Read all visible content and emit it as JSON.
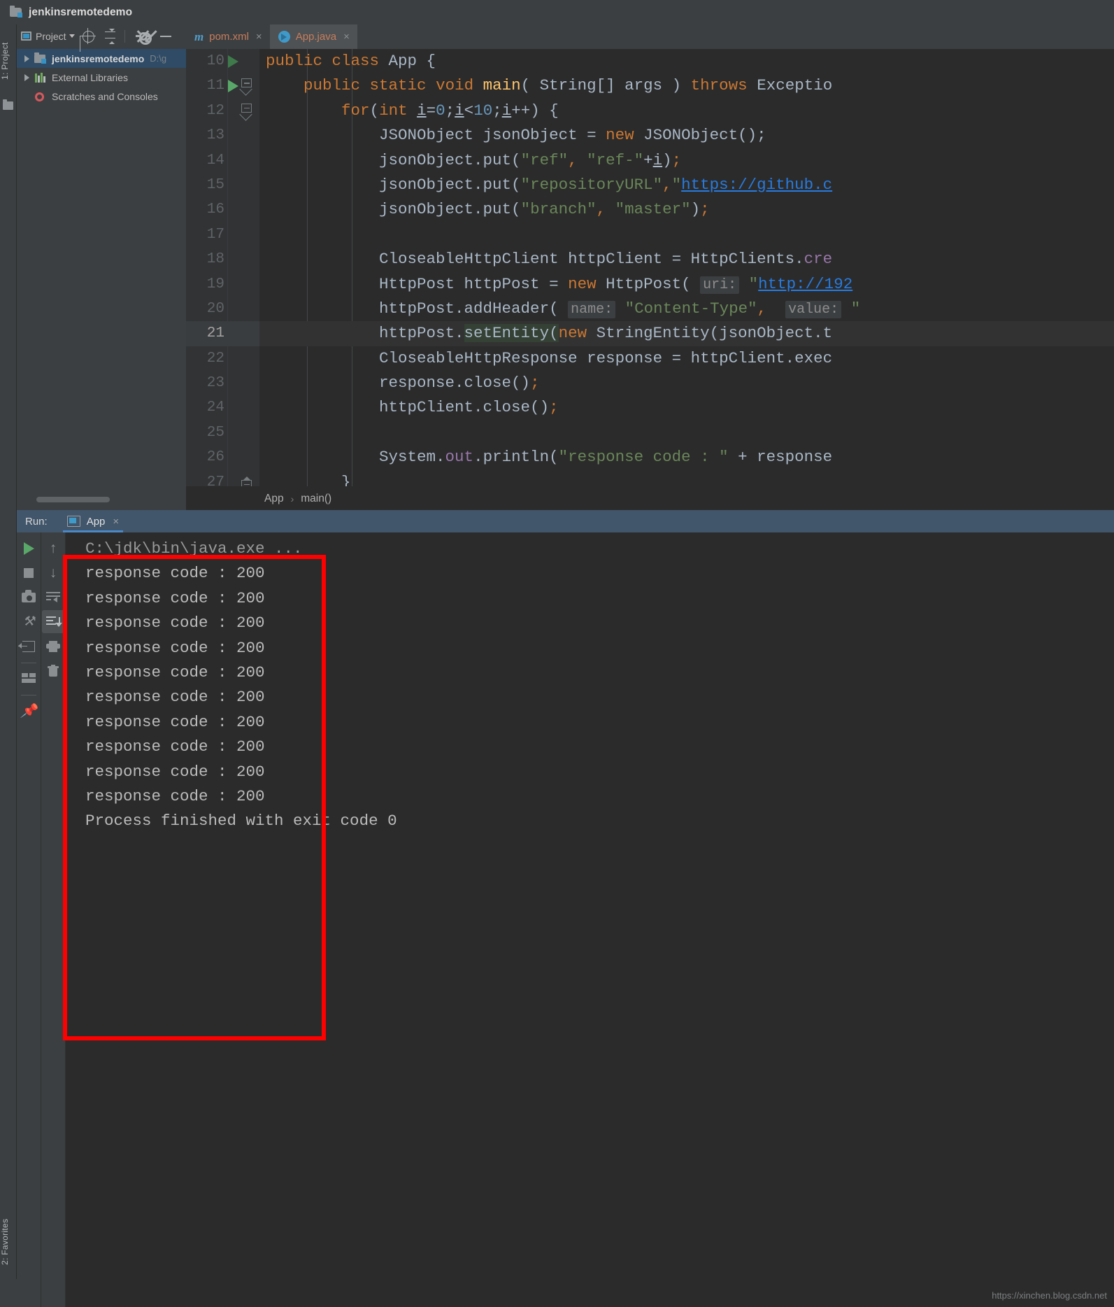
{
  "window": {
    "title": "jenkinsremotedemo",
    "project_icon": "project-folder-icon"
  },
  "left_strip": {
    "project_tab": "1: Project",
    "favorites_tab": "2: Favorites"
  },
  "project_panel": {
    "title": "Project",
    "buttons": [
      "locate-button",
      "collapse-all-button",
      "settings-button",
      "hide-button"
    ],
    "tree": [
      {
        "label": "jenkinsremotedemo",
        "path": "D:\\g",
        "icon": "project-folder-icon",
        "selected": true
      },
      {
        "label": "External Libraries",
        "path": "",
        "icon": "libraries-icon",
        "selected": false
      },
      {
        "label": "Scratches and Consoles",
        "path": "",
        "icon": "scratches-icon",
        "selected": false
      }
    ]
  },
  "editor": {
    "tabs": [
      {
        "label": "pom.xml",
        "icon": "maven-icon",
        "active": false
      },
      {
        "label": "App.java",
        "icon": "java-class-icon",
        "active": true
      }
    ],
    "first_line_number": 10,
    "current_line": 21,
    "breadcrumb": [
      "App",
      "main()"
    ],
    "lines": [
      {
        "n": 10,
        "run_marker": "dim",
        "fold": "none",
        "html": "<span class=\"kw\">public</span> <span class=\"kw\">class</span> App {"
      },
      {
        "n": 11,
        "run_marker": "full",
        "fold": "start",
        "html": "    <span class=\"kw\">public</span> <span class=\"kw\">static</span> <span class=\"kw\">void</span> <span class=\"mth\">main</span>( String[] args ) <span class=\"kw\">throws</span> Exceptio"
      },
      {
        "n": 12,
        "run_marker": "none",
        "fold": "start",
        "html": "        <span class=\"kw\">for</span>(<span class=\"kw\">int</span> <span class=\"var-u\">i</span>=<span class=\"num\">0</span>;<span class=\"var-u\">i</span>&lt;<span class=\"num\">10</span>;<span class=\"var-u\">i</span>++) {"
      },
      {
        "n": 13,
        "run_marker": "none",
        "fold": "none",
        "html": "            JSONObject jsonObject = <span class=\"kw\">new</span> JSONObject();"
      },
      {
        "n": 14,
        "run_marker": "none",
        "fold": "none",
        "html": "            jsonObject.put(<span class=\"str\">\"ref\"</span><span class=\"kw\">,</span> <span class=\"str\">\"ref-\"</span>+<span class=\"var-u\">i</span>)<span class=\"kw\">;</span>"
      },
      {
        "n": 15,
        "run_marker": "none",
        "fold": "none",
        "html": "            jsonObject.put(<span class=\"str\">\"repositoryURL\"</span><span class=\"kw\">,</span><span class=\"str\">\"</span><span class=\"link\">https://github.c</span>"
      },
      {
        "n": 16,
        "run_marker": "none",
        "fold": "none",
        "html": "            jsonObject.put(<span class=\"str\">\"branch\"</span><span class=\"kw\">,</span> <span class=\"str\">\"master\"</span>)<span class=\"kw\">;</span>"
      },
      {
        "n": 17,
        "run_marker": "none",
        "fold": "none",
        "html": ""
      },
      {
        "n": 18,
        "run_marker": "none",
        "fold": "none",
        "html": "            CloseableHttpClient httpClient = HttpClients.<span class=\"fld\">cre</span>"
      },
      {
        "n": 19,
        "run_marker": "none",
        "fold": "none",
        "html": "            HttpPost httpPost = <span class=\"kw\">new</span> HttpPost( <span class=\"hint\">uri:</span> <span class=\"str\">\"</span><span class=\"link\">http://192</span>"
      },
      {
        "n": 20,
        "run_marker": "none",
        "fold": "none",
        "html": "            httpPost.addHeader( <span class=\"hint\">name:</span> <span class=\"str\">\"Content-Type\"</span><span class=\"kw\">,</span>  <span class=\"hint\">value:</span> <span class=\"str\">\"</span>"
      },
      {
        "n": 21,
        "run_marker": "none",
        "fold": "none",
        "html": "            httpPost.<span class=\"selhl\">setEntity(</span><span class=\"kw\">new</span> StringEntity(jsonObject.t"
      },
      {
        "n": 22,
        "run_marker": "none",
        "fold": "none",
        "html": "            CloseableHttpResponse response = httpClient.exec"
      },
      {
        "n": 23,
        "run_marker": "none",
        "fold": "none",
        "html": "            response.close()<span class=\"kw\">;</span>"
      },
      {
        "n": 24,
        "run_marker": "none",
        "fold": "none",
        "html": "            httpClient.close()<span class=\"kw\">;</span>"
      },
      {
        "n": 25,
        "run_marker": "none",
        "fold": "none",
        "html": ""
      },
      {
        "n": 26,
        "run_marker": "none",
        "fold": "none",
        "html": "            System.<span class=\"fld\">out</span>.println(<span class=\"str\">\"response code : \"</span> + response"
      },
      {
        "n": 27,
        "run_marker": "none",
        "fold": "end",
        "html": "        }"
      }
    ]
  },
  "run_panel": {
    "header_label": "Run:",
    "tab_label": "App",
    "tab_close": "×",
    "toolbar_left": [
      "rerun-button",
      "stop-button",
      "screenshot-button",
      "dump-threads-button",
      "restore-layout-button",
      "layout-button",
      "pin-tab-button"
    ],
    "toolbar_right": [
      "up-stack-trace-button",
      "down-stack-trace-button",
      "soft-wrap-button",
      "scroll-to-end-button",
      "print-button",
      "clear-all-button"
    ],
    "console": {
      "command": "C:\\jdk\\bin\\java.exe ...",
      "output_lines": [
        "response code : 200",
        "response code : 200",
        "response code : 200",
        "response code : 200",
        "response code : 200",
        "response code : 200",
        "response code : 200",
        "response code : 200",
        "response code : 200",
        "response code : 200"
      ],
      "exit_line": "Process finished with exit code 0"
    }
  },
  "annotation": {
    "highlight_color": "#fe0000"
  },
  "watermark": "https://xinchen.blog.csdn.net"
}
